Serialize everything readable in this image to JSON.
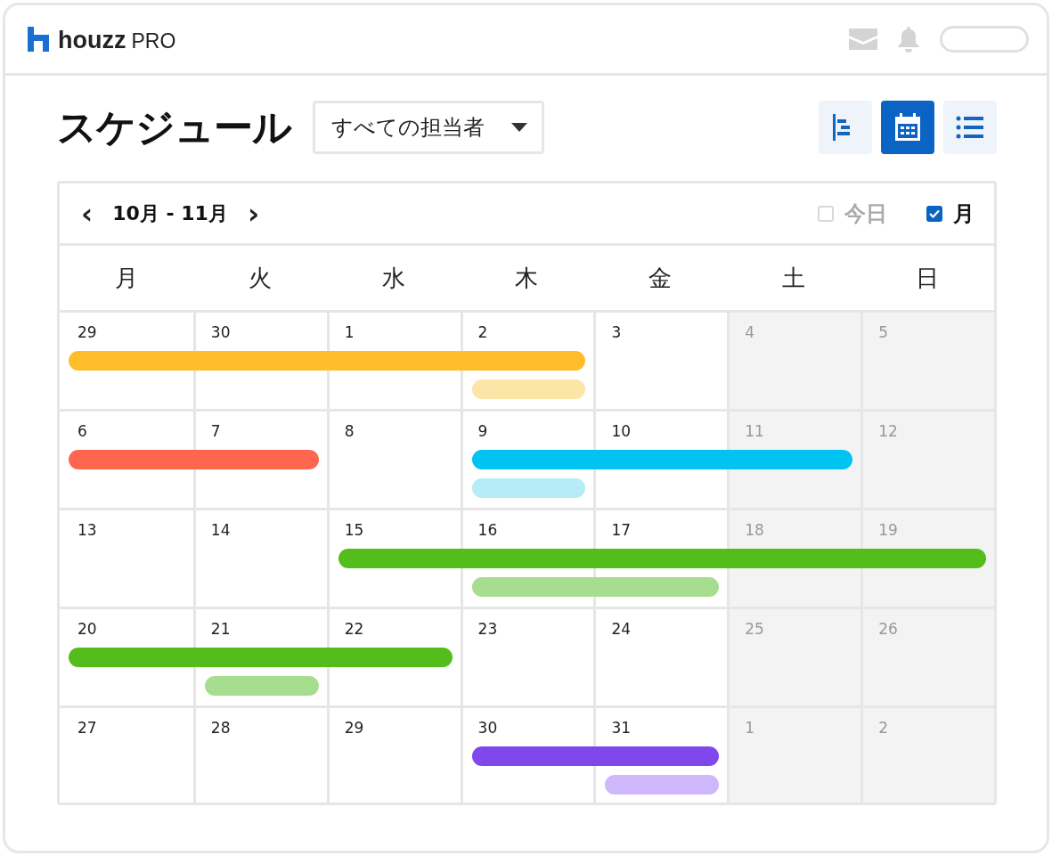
{
  "header": {
    "logo_word": "houzz",
    "logo_suffix": "PRO"
  },
  "title": "スケジュール",
  "assignee_dropdown": {
    "value": "すべての担当者"
  },
  "views": [
    {
      "kind": "gantt",
      "selected": false
    },
    {
      "kind": "calendar",
      "selected": true
    },
    {
      "kind": "list",
      "selected": false
    }
  ],
  "range": {
    "prev": "‹",
    "label": "10月 - 11月",
    "next": "›"
  },
  "toggles": [
    {
      "label": "今日",
      "checked": false
    },
    {
      "label": "月",
      "checked": true
    }
  ],
  "weekdays": [
    {
      "label": "月",
      "weekend": false
    },
    {
      "label": "火",
      "weekend": false
    },
    {
      "label": "水",
      "weekend": false
    },
    {
      "label": "木",
      "weekend": false
    },
    {
      "label": "金",
      "weekend": false
    },
    {
      "label": "土",
      "weekend": true
    },
    {
      "label": "日",
      "weekend": true
    }
  ],
  "weeks": [
    {
      "days": [
        {
          "label": "29",
          "bars": [
            {
              "kind": "main",
              "color": "#ffbd2a"
            }
          ]
        },
        {
          "label": "30",
          "bars": [
            {
              "kind": "main",
              "color": "#ffbd2a"
            }
          ]
        },
        {
          "label": "1",
          "bars": [
            {
              "kind": "main",
              "color": "#ffbd2a"
            }
          ]
        },
        {
          "label": "2",
          "bars": [
            {
              "kind": "main",
              "color": "#ffbd2a"
            },
            {
              "kind": "sub",
              "color": "#fde5a8"
            }
          ]
        },
        {
          "label": "3"
        },
        {
          "label": "4"
        },
        {
          "label": "5"
        }
      ]
    },
    {
      "days": [
        {
          "label": "6",
          "bars": [
            {
              "kind": "main",
              "color": "#ff6650"
            }
          ]
        },
        {
          "label": "7",
          "bars": [
            {
              "kind": "main",
              "color": "#ff6650"
            }
          ]
        },
        {
          "label": "8"
        },
        {
          "label": "9",
          "bars": [
            {
              "kind": "main",
              "color": "#00c3f2"
            },
            {
              "kind": "sub",
              "color": "#b5ecf6"
            }
          ]
        },
        {
          "label": "10",
          "bars": [
            {
              "kind": "main",
              "color": "#00c3f2"
            }
          ]
        },
        {
          "label": "11",
          "bars": [
            {
              "kind": "main",
              "color": "#00c3f2"
            }
          ]
        },
        {
          "label": "12"
        }
      ]
    },
    {
      "days": [
        {
          "label": "13"
        },
        {
          "label": "14"
        },
        {
          "label": "15",
          "bars": [
            {
              "kind": "main",
              "color": "#52bd1b"
            }
          ]
        },
        {
          "label": "16",
          "bars": [
            {
              "kind": "main",
              "color": "#52bd1b"
            },
            {
              "kind": "sub",
              "color": "#a7dd8e"
            }
          ]
        },
        {
          "label": "17",
          "bars": [
            {
              "kind": "main",
              "color": "#52bd1b"
            },
            {
              "kind": "sub",
              "color": "#a7dd8e"
            }
          ]
        },
        {
          "label": "18",
          "bars": [
            {
              "kind": "main",
              "color": "#52bd1b"
            }
          ]
        },
        {
          "label": "19",
          "bars": [
            {
              "kind": "main",
              "color": "#52bd1b"
            }
          ]
        }
      ]
    },
    {
      "days": [
        {
          "label": "20",
          "bars": [
            {
              "kind": "main",
              "color": "#52bd1b"
            }
          ]
        },
        {
          "label": "21",
          "bars": [
            {
              "kind": "main",
              "color": "#52bd1b"
            },
            {
              "kind": "sub",
              "color": "#a7dd8e"
            }
          ]
        },
        {
          "label": "22",
          "bars": [
            {
              "kind": "main",
              "color": "#52bd1b"
            }
          ]
        },
        {
          "label": "23"
        },
        {
          "label": "24"
        },
        {
          "label": "25"
        },
        {
          "label": "26"
        }
      ]
    },
    {
      "days": [
        {
          "label": "27"
        },
        {
          "label": "28"
        },
        {
          "label": "29"
        },
        {
          "label": "30",
          "bars": [
            {
              "kind": "main",
              "color": "#7f47ec"
            }
          ]
        },
        {
          "label": "31",
          "bars": [
            {
              "kind": "main",
              "color": "#7f47ec"
            },
            {
              "kind": "sub",
              "color": "#cfb7fc"
            }
          ]
        },
        {
          "label": "1"
        },
        {
          "label": "2"
        }
      ]
    }
  ]
}
